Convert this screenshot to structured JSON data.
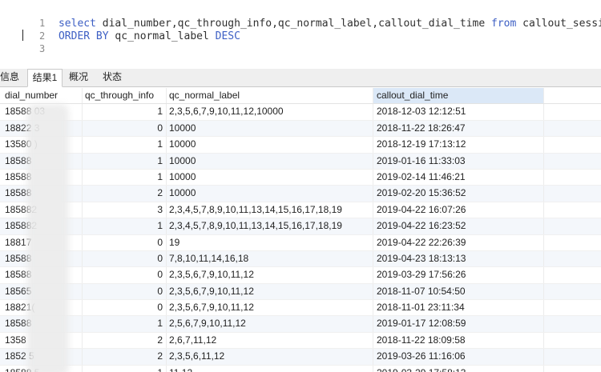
{
  "editor": {
    "lines": [
      {
        "num": "1",
        "kw1": "select",
        "text1": " dial_number,qc_through_info,qc_normal_label,callout_dial_time ",
        "kw2": "from",
        "text2": " callout_session"
      },
      {
        "num": "2",
        "kw1": "ORDER BY",
        "text1": " qc_normal_label ",
        "kw2": "DESC",
        "text2": ""
      },
      {
        "num": "3",
        "kw1": "",
        "text1": "",
        "kw2": "",
        "text2": ""
      }
    ]
  },
  "tabs": [
    {
      "label": "信息"
    },
    {
      "label": "结果1"
    },
    {
      "label": "概况"
    },
    {
      "label": "状态"
    }
  ],
  "grid": {
    "columns": [
      "dial_number",
      "qc_through_info",
      "qc_normal_label",
      "callout_dial_time"
    ],
    "rows": [
      {
        "dial": "18588    03",
        "through": "1",
        "label": "2,3,5,6,7,9,10,11,12,10000",
        "time": "2018-12-03 12:12:51"
      },
      {
        "dial": "18822    3",
        "through": "0",
        "label": "10000",
        "time": "2018-11-22 18:26:47"
      },
      {
        "dial": "13580    )",
        "through": "1",
        "label": "10000",
        "time": "2018-12-19 17:13:12"
      },
      {
        "dial": "18588",
        "through": "1",
        "label": "10000",
        "time": "2019-01-16 11:33:03"
      },
      {
        "dial": "18588",
        "through": "1",
        "label": "10000",
        "time": "2019-02-14 11:46:21"
      },
      {
        "dial": "18588",
        "through": "2",
        "label": "10000",
        "time": "2019-02-20 15:36:52"
      },
      {
        "dial": "185882",
        "through": "3",
        "label": "2,3,4,5,7,8,9,10,11,13,14,15,16,17,18,19",
        "time": "2019-04-22 16:07:26"
      },
      {
        "dial": "185882",
        "through": "1",
        "label": "2,3,4,5,7,8,9,10,11,13,14,15,16,17,18,19",
        "time": "2019-04-22 16:23:52"
      },
      {
        "dial": "18817",
        "through": "0",
        "label": "19",
        "time": "2019-04-22 22:26:39"
      },
      {
        "dial": "18588",
        "through": "0",
        "label": "7,8,10,11,14,16,18",
        "time": "2019-04-23 18:13:13"
      },
      {
        "dial": "18588",
        "through": "0",
        "label": "2,3,5,6,7,9,10,11,12",
        "time": "2019-03-29 17:56:26"
      },
      {
        "dial": "18565",
        "through": "0",
        "label": "2,3,5,6,7,9,10,11,12",
        "time": "2018-11-07 10:54:50"
      },
      {
        "dial": "18821(",
        "through": "0",
        "label": "2,3,5,6,7,9,10,11,12",
        "time": "2018-11-01 23:11:34"
      },
      {
        "dial": "18588",
        "through": "1",
        "label": "2,5,6,7,9,10,11,12",
        "time": "2019-01-17 12:08:59"
      },
      {
        "dial": "1358",
        "through": "2",
        "label": "2,6,7,11,12",
        "time": "2018-11-22 18:09:58"
      },
      {
        "dial": "1852    5",
        "through": "2",
        "label": "2,3,5,6,11,12",
        "time": "2019-03-26 11:16:06"
      },
      {
        "dial": "18588    5",
        "through": "1",
        "label": "11,12",
        "time": "2019-03-29 17:58:13"
      }
    ]
  }
}
